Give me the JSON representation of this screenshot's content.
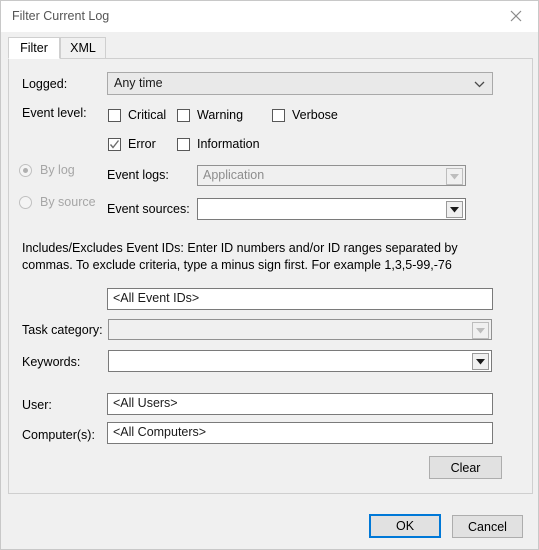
{
  "window": {
    "title": "Filter Current Log",
    "close_icon": "close-icon"
  },
  "tabs": [
    {
      "label": "Filter",
      "active": true
    },
    {
      "label": "XML",
      "active": false
    }
  ],
  "form": {
    "logged": {
      "label": "Logged:",
      "value": "Any time",
      "icon": "chevron-down-icon"
    },
    "event_level": {
      "label": "Event level:",
      "options": [
        {
          "label": "Critical",
          "checked": false
        },
        {
          "label": "Warning",
          "checked": false
        },
        {
          "label": "Verbose",
          "checked": false
        },
        {
          "label": "Error",
          "checked": true
        },
        {
          "label": "Information",
          "checked": false
        }
      ]
    },
    "source_mode": {
      "by_log": {
        "label": "By log",
        "selected": true,
        "enabled": false
      },
      "by_source": {
        "label": "By source",
        "selected": false,
        "enabled": false
      }
    },
    "event_logs": {
      "label": "Event logs:",
      "value": "Application",
      "enabled": false,
      "icon": "dropdown-arrow-icon"
    },
    "event_sources": {
      "label": "Event sources:",
      "value": "",
      "enabled": true,
      "icon": "dropdown-arrow-icon"
    },
    "event_ids_help": "Includes/Excludes Event IDs: Enter ID numbers and/or ID ranges separated by commas. To exclude criteria, type a minus sign first. For example 1,3,5-99,-76",
    "event_ids": {
      "value": "<All Event IDs>"
    },
    "task_category": {
      "label": "Task category:",
      "value": "",
      "enabled": false,
      "icon": "dropdown-arrow-icon"
    },
    "keywords": {
      "label": "Keywords:",
      "value": "",
      "enabled": true,
      "icon": "dropdown-arrow-icon"
    },
    "user": {
      "label": "User:",
      "value": "<All Users>"
    },
    "computers": {
      "label": "Computer(s):",
      "value": "<All Computers>"
    },
    "clear_button": "Clear"
  },
  "footer": {
    "ok": "OK",
    "cancel": "Cancel"
  },
  "colors": {
    "accent": "#0078d7",
    "dialog_bg": "#f0f0f0",
    "titlebar_bg": "#ffffff",
    "disabled_text": "#a6a6a6"
  }
}
